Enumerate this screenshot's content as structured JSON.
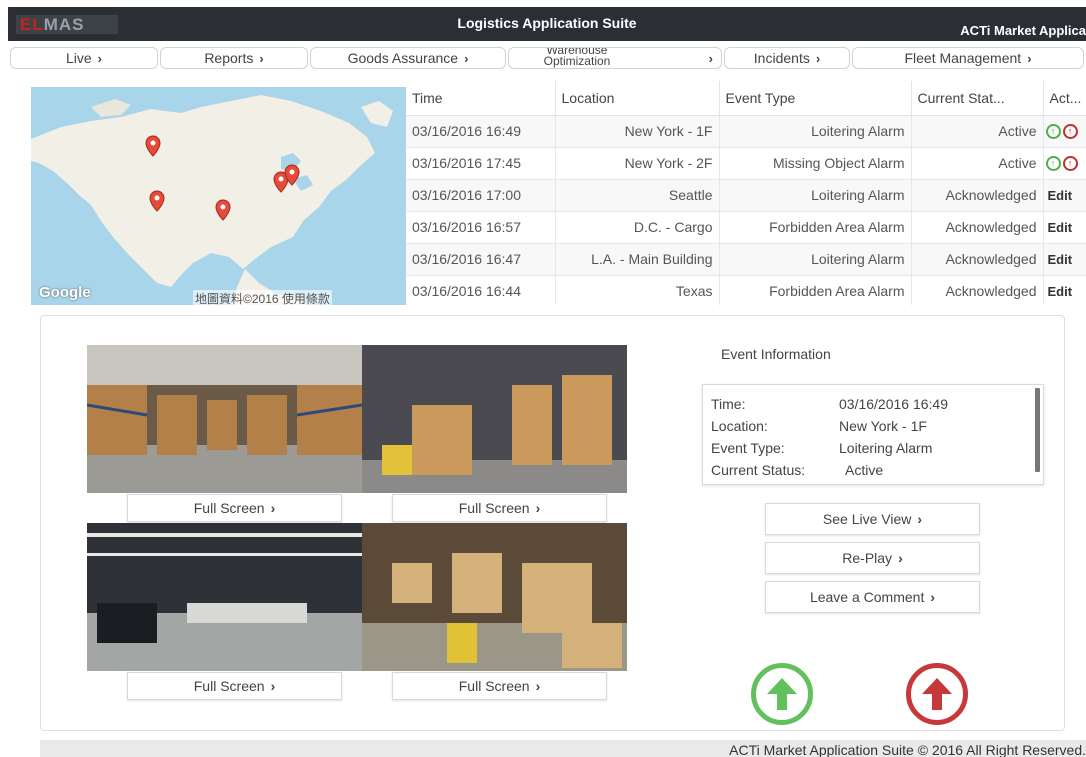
{
  "header": {
    "logo_text": "ELMAS",
    "title": "Logistics Application Suite",
    "suite": "ACTi Market Applica"
  },
  "nav": {
    "tabs": [
      {
        "label": "Live"
      },
      {
        "label": "Reports"
      },
      {
        "label": "Goods Assurance"
      },
      {
        "label": "Warenouse Optimization"
      },
      {
        "label": "Incidents"
      },
      {
        "label": "Fleet Management"
      }
    ],
    "chevron": "›"
  },
  "map": {
    "brand": "Google",
    "attribution": "地圖資料©2016 使用條款",
    "markers": 6,
    "colors": {
      "water": "#a9d5ea",
      "land": "#f2efe6",
      "marker": "#e64a3b"
    }
  },
  "events": {
    "columns": [
      "Time",
      "Location",
      "Event Type",
      "Current Stat...",
      "Act..."
    ],
    "rows": [
      {
        "time": "03/16/2016 16:49",
        "location": "New York - 1F",
        "event_type": "Loitering Alarm",
        "status": "Active",
        "action": "icons"
      },
      {
        "time": "03/16/2016 17:45",
        "location": "New York - 2F",
        "event_type": "Missing Object Alarm",
        "status": "Active",
        "action": "icons"
      },
      {
        "time": "03/16/2016 17:00",
        "location": "Seattle",
        "event_type": "Loitering Alarm",
        "status": "Acknowledged",
        "action": "Edit"
      },
      {
        "time": "03/16/2016 16:57",
        "location": "D.C. - Cargo",
        "event_type": "Forbidden Area Alarm",
        "status": "Acknowledged",
        "action": "Edit"
      },
      {
        "time": "03/16/2016 16:47",
        "location": "L.A. - Main Building",
        "event_type": "Loitering Alarm",
        "status": "Acknowledged",
        "action": "Edit"
      },
      {
        "time": "03/16/2016 16:44",
        "location": "Texas",
        "event_type": "Forbidden Area Alarm",
        "status": "Acknowledged",
        "action": "Edit"
      }
    ]
  },
  "cameras": {
    "full_screen_label": "Full Screen",
    "count": 4
  },
  "event_info": {
    "title": "Event Information",
    "fields": [
      {
        "key": "Time:",
        "value": "03/16/2016 16:49"
      },
      {
        "key": "Location:",
        "value": "New York - 1F"
      },
      {
        "key": "Event Type:",
        "value": "Loitering Alarm"
      },
      {
        "key": "Current Status:",
        "value": "Active"
      }
    ]
  },
  "actions": {
    "see_live_view": "See Live View",
    "replay": "Re-Play",
    "leave_comment": "Leave a Comment",
    "chevron": "›"
  },
  "footer": {
    "text": "ACTi Market Application Suite © 2016 All Right Reserved."
  },
  "colors": {
    "titlebar": "#2b2f35",
    "accept_green": "#62c15d",
    "escalate_red": "#c7383a"
  }
}
